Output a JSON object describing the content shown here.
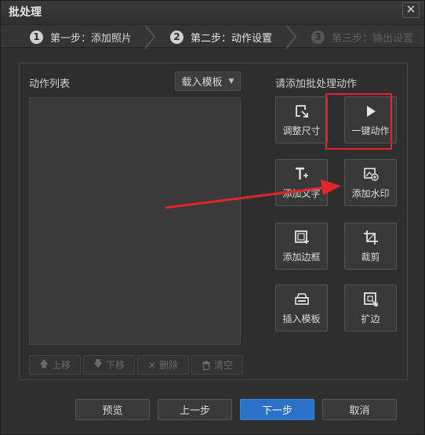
{
  "window": {
    "title": "批处理",
    "close_label": "✕"
  },
  "steps": [
    {
      "num": "1",
      "label": "第一步：添加照片"
    },
    {
      "num": "2",
      "label": "第二步：动作设置"
    },
    {
      "num": "3",
      "label": "第三步：输出设置"
    }
  ],
  "left": {
    "title": "动作列表",
    "load_template": "载入模板",
    "tools": [
      {
        "icon": "arrow-up-icon",
        "label": "上移"
      },
      {
        "icon": "arrow-down-icon",
        "label": "下移"
      },
      {
        "icon": "x-icon",
        "label": "删除"
      },
      {
        "icon": "trash-icon",
        "label": "清空"
      }
    ]
  },
  "right": {
    "title": "请添加批处理动作",
    "actions": [
      {
        "icon": "resize-icon",
        "label": "调整尺寸"
      },
      {
        "icon": "play-icon",
        "label": "一键动作"
      },
      {
        "icon": "text-add-icon",
        "label": "添加文字"
      },
      {
        "icon": "watermark-icon",
        "label": "添加水印"
      },
      {
        "icon": "frame-add-icon",
        "label": "添加边框"
      },
      {
        "icon": "crop-icon",
        "label": "裁剪"
      },
      {
        "icon": "template-insert-icon",
        "label": "插入模板"
      },
      {
        "icon": "expand-edge-icon",
        "label": "扩边"
      }
    ]
  },
  "footer": {
    "preview": "预览",
    "prev": "上一步",
    "next": "下一步",
    "cancel": "取消"
  },
  "colors": {
    "accent": "#2a72c8",
    "highlight_border": "#e0252b",
    "annotation_arrow": "#e0252b"
  }
}
